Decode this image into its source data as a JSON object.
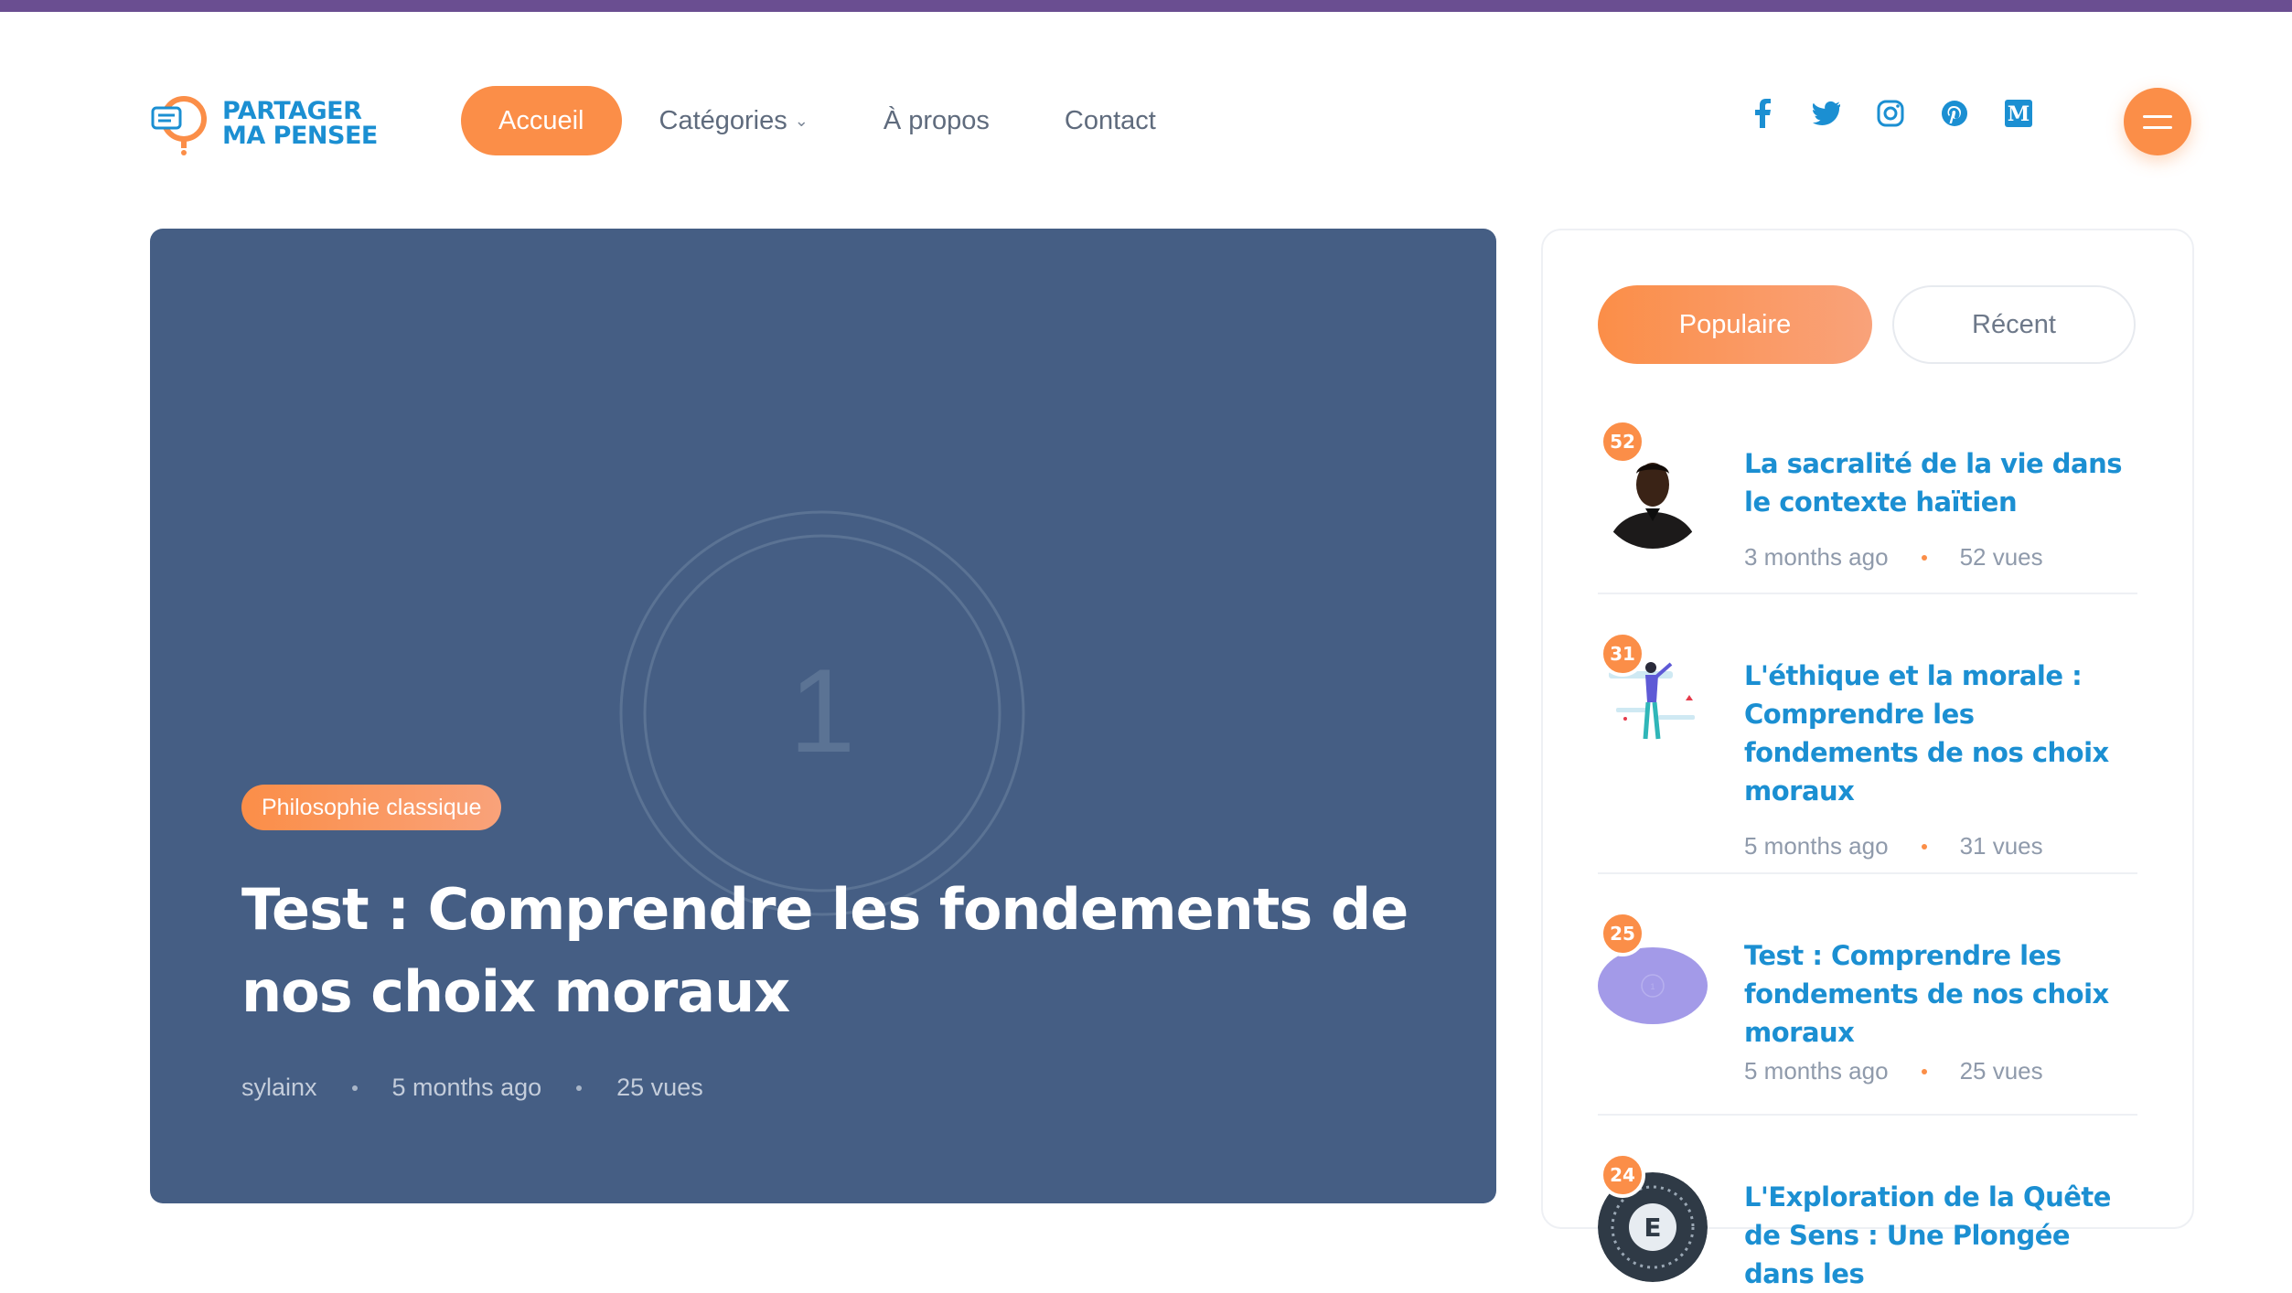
{
  "brand": {
    "line1": "PARTAGER",
    "line2": "MA PENSEE"
  },
  "nav": {
    "home": "Accueil",
    "categories": "Catégories",
    "about": "À propos",
    "contact": "Contact"
  },
  "social_icons": [
    "facebook-icon",
    "twitter-icon",
    "instagram-icon",
    "pinterest-icon",
    "medium-icon"
  ],
  "colors": {
    "accent": "#fb8e48",
    "link": "#1b8fd2",
    "hero_bg": "#455e84",
    "topbar": "#6a4e91"
  },
  "hero": {
    "number": "1",
    "category": "Philosophie classique",
    "title": "Test : Comprendre les fondements de nos choix moraux",
    "author": "sylainx",
    "date": "5 months ago",
    "views": "25 vues"
  },
  "sidebar": {
    "tabs": {
      "popular": "Populaire",
      "recent": "Récent"
    },
    "posts": [
      {
        "badge": "52",
        "title": "La sacralité de la vie dans le contexte haïtien",
        "date": "3 months ago",
        "views": "52 vues",
        "thumb": "portrait"
      },
      {
        "badge": "31",
        "title": "L'éthique et la morale : Comprendre les fondements de nos choix moraux",
        "date": "5 months ago",
        "views": "31 vues",
        "thumb": "illustration"
      },
      {
        "badge": "25",
        "title": "Test : Comprendre les fondements de nos choix moraux",
        "date": "5 months ago",
        "views": "25 vues",
        "thumb": "placeholder"
      },
      {
        "badge": "24",
        "title": "L'Exploration de la Quête de Sens : Une Plongée dans les",
        "thumb": "dial"
      }
    ]
  }
}
